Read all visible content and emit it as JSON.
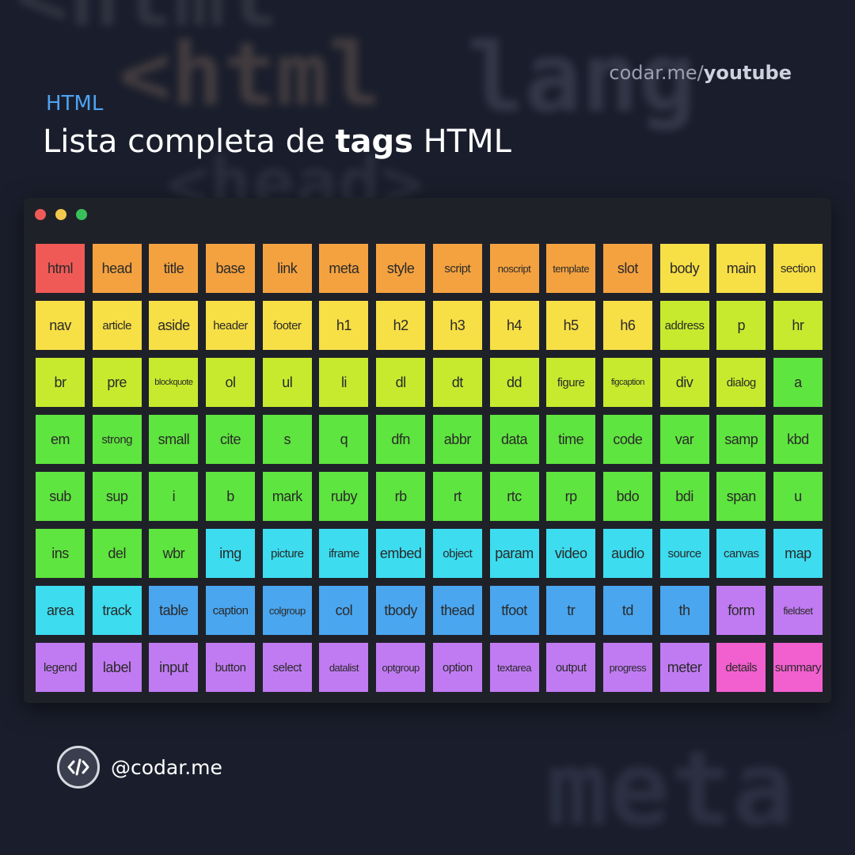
{
  "header": {
    "subtitle": "HTML",
    "title_pre": "Lista completa de ",
    "title_bold": "tags",
    "title_post": " HTML",
    "url_base": "codar.me/",
    "url_path": "youtube"
  },
  "background_words": [
    "<html",
    "lang",
    "<head>",
    "meta"
  ],
  "colors": {
    "background": "#1a1e2c",
    "window": "#1f2129",
    "subtitle": "#4da3f2",
    "red": "#ef5a57",
    "orange": "#f4a240",
    "yellow": "#f7df46",
    "lime": "#c8ea2e",
    "green": "#5fe53f",
    "cyan": "#3ddcef",
    "blue": "#4aa6ef",
    "purple": "#c07bf2",
    "pink": "#f25fce"
  },
  "tags": [
    {
      "name": "html",
      "color": "red"
    },
    {
      "name": "head",
      "color": "orange"
    },
    {
      "name": "title",
      "color": "orange"
    },
    {
      "name": "base",
      "color": "orange"
    },
    {
      "name": "link",
      "color": "orange"
    },
    {
      "name": "meta",
      "color": "orange"
    },
    {
      "name": "style",
      "color": "orange"
    },
    {
      "name": "script",
      "color": "orange"
    },
    {
      "name": "noscript",
      "color": "orange"
    },
    {
      "name": "template",
      "color": "orange"
    },
    {
      "name": "slot",
      "color": "orange"
    },
    {
      "name": "body",
      "color": "yellow"
    },
    {
      "name": "main",
      "color": "yellow"
    },
    {
      "name": "section",
      "color": "yellow"
    },
    {
      "name": "nav",
      "color": "yellow"
    },
    {
      "name": "article",
      "color": "yellow"
    },
    {
      "name": "aside",
      "color": "yellow"
    },
    {
      "name": "header",
      "color": "yellow"
    },
    {
      "name": "footer",
      "color": "yellow"
    },
    {
      "name": "h1",
      "color": "yellow"
    },
    {
      "name": "h2",
      "color": "yellow"
    },
    {
      "name": "h3",
      "color": "yellow"
    },
    {
      "name": "h4",
      "color": "yellow"
    },
    {
      "name": "h5",
      "color": "yellow"
    },
    {
      "name": "h6",
      "color": "yellow"
    },
    {
      "name": "address",
      "color": "lime"
    },
    {
      "name": "p",
      "color": "lime"
    },
    {
      "name": "hr",
      "color": "lime"
    },
    {
      "name": "br",
      "color": "lime"
    },
    {
      "name": "pre",
      "color": "lime"
    },
    {
      "name": "blockquote",
      "color": "lime"
    },
    {
      "name": "ol",
      "color": "lime"
    },
    {
      "name": "ul",
      "color": "lime"
    },
    {
      "name": "li",
      "color": "lime"
    },
    {
      "name": "dl",
      "color": "lime"
    },
    {
      "name": "dt",
      "color": "lime"
    },
    {
      "name": "dd",
      "color": "lime"
    },
    {
      "name": "figure",
      "color": "lime"
    },
    {
      "name": "figcaption",
      "color": "lime"
    },
    {
      "name": "div",
      "color": "lime"
    },
    {
      "name": "dialog",
      "color": "lime"
    },
    {
      "name": "a",
      "color": "green"
    },
    {
      "name": "em",
      "color": "green"
    },
    {
      "name": "strong",
      "color": "green"
    },
    {
      "name": "small",
      "color": "green"
    },
    {
      "name": "cite",
      "color": "green"
    },
    {
      "name": "s",
      "color": "green"
    },
    {
      "name": "q",
      "color": "green"
    },
    {
      "name": "dfn",
      "color": "green"
    },
    {
      "name": "abbr",
      "color": "green"
    },
    {
      "name": "data",
      "color": "green"
    },
    {
      "name": "time",
      "color": "green"
    },
    {
      "name": "code",
      "color": "green"
    },
    {
      "name": "var",
      "color": "green"
    },
    {
      "name": "samp",
      "color": "green"
    },
    {
      "name": "kbd",
      "color": "green"
    },
    {
      "name": "sub",
      "color": "green"
    },
    {
      "name": "sup",
      "color": "green"
    },
    {
      "name": "i",
      "color": "green"
    },
    {
      "name": "b",
      "color": "green"
    },
    {
      "name": "mark",
      "color": "green"
    },
    {
      "name": "ruby",
      "color": "green"
    },
    {
      "name": "rb",
      "color": "green"
    },
    {
      "name": "rt",
      "color": "green"
    },
    {
      "name": "rtc",
      "color": "green"
    },
    {
      "name": "rp",
      "color": "green"
    },
    {
      "name": "bdo",
      "color": "green"
    },
    {
      "name": "bdi",
      "color": "green"
    },
    {
      "name": "span",
      "color": "green"
    },
    {
      "name": "u",
      "color": "green"
    },
    {
      "name": "ins",
      "color": "green"
    },
    {
      "name": "del",
      "color": "green"
    },
    {
      "name": "wbr",
      "color": "green"
    },
    {
      "name": "img",
      "color": "cyan"
    },
    {
      "name": "picture",
      "color": "cyan"
    },
    {
      "name": "iframe",
      "color": "cyan"
    },
    {
      "name": "embed",
      "color": "cyan"
    },
    {
      "name": "object",
      "color": "cyan"
    },
    {
      "name": "param",
      "color": "cyan"
    },
    {
      "name": "video",
      "color": "cyan"
    },
    {
      "name": "audio",
      "color": "cyan"
    },
    {
      "name": "source",
      "color": "cyan"
    },
    {
      "name": "canvas",
      "color": "cyan"
    },
    {
      "name": "map",
      "color": "cyan"
    },
    {
      "name": "area",
      "color": "cyan"
    },
    {
      "name": "track",
      "color": "cyan"
    },
    {
      "name": "table",
      "color": "blue"
    },
    {
      "name": "caption",
      "color": "blue"
    },
    {
      "name": "colgroup",
      "color": "blue"
    },
    {
      "name": "col",
      "color": "blue"
    },
    {
      "name": "tbody",
      "color": "blue"
    },
    {
      "name": "thead",
      "color": "blue"
    },
    {
      "name": "tfoot",
      "color": "blue"
    },
    {
      "name": "tr",
      "color": "blue"
    },
    {
      "name": "td",
      "color": "blue"
    },
    {
      "name": "th",
      "color": "blue"
    },
    {
      "name": "form",
      "color": "purple"
    },
    {
      "name": "fieldset",
      "color": "purple"
    },
    {
      "name": "legend",
      "color": "purple"
    },
    {
      "name": "label",
      "color": "purple"
    },
    {
      "name": "input",
      "color": "purple"
    },
    {
      "name": "button",
      "color": "purple"
    },
    {
      "name": "select",
      "color": "purple"
    },
    {
      "name": "datalist",
      "color": "purple"
    },
    {
      "name": "optgroup",
      "color": "purple"
    },
    {
      "name": "option",
      "color": "purple"
    },
    {
      "name": "textarea",
      "color": "purple"
    },
    {
      "name": "output",
      "color": "purple"
    },
    {
      "name": "progress",
      "color": "purple"
    },
    {
      "name": "meter",
      "color": "purple"
    },
    {
      "name": "details",
      "color": "pink"
    },
    {
      "name": "summary",
      "color": "pink"
    }
  ],
  "footer": {
    "logo_icon": "code-slash-icon",
    "handle": "@codar.me"
  }
}
